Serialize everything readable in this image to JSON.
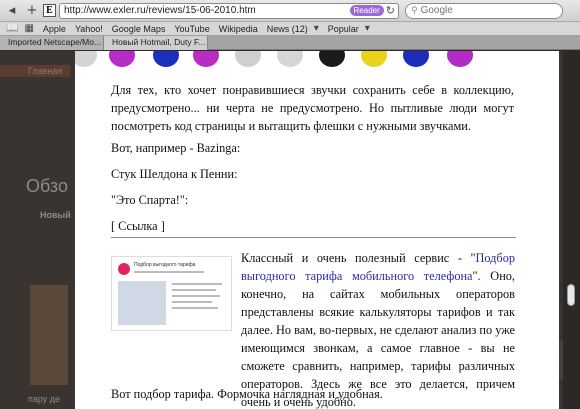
{
  "toolbar": {
    "back_icon": "back-icon",
    "add_icon": "add-bookmark-icon",
    "url": "http://www.exler.ru/reviews/15-06-2010.htm",
    "reader_label": "Reader",
    "search_placeholder": "Google"
  },
  "bookmarks": {
    "items": [
      "Apple",
      "Yahoo!",
      "Google Maps",
      "YouTube",
      "Wikipedia",
      "News (12)",
      "Popular"
    ]
  },
  "tabs": [
    {
      "label": "Imported Netscape/Mo..."
    },
    {
      "label": "Новый Hotmail, Duty F..."
    }
  ],
  "background": {
    "nav": "Главная",
    "heading": "Обзо",
    "label": "Новый",
    "caption": "пару  де"
  },
  "article": {
    "p1": "Для тех, кто хочет понравившиеся звучки сохранить себе в коллекцию, предусмотрено... ни черта не предусмотрено. Но пытливые люди могут посмотреть код страницы и вытащить флешки с нужными звучками.",
    "p2": "Вот, например - Bazinga:",
    "p3": "Стук Шелдона к Пенни:",
    "p4": "\"Это Спарта!\":",
    "p5": "[ Ссылка ]",
    "p6_before": "Классный и очень полезный сервис - \"",
    "p6_link": "Подбор выгодного тарифа мобильного телефона",
    "p6_after": "\". Оно, конечно, на сайтах мобильных операторов представлены всякие калькуляторы тарифов и так далее. Но вам, во-первых, не сделают анализ по уже имеющимся звонкам, а самое главное - вы не сможете сравнить, например, тарифы различных операторов. Здесь же все это делается, причем очень и очень удобно.",
    "p7": "Вот подбор тарифа. Формочка наглядная и удобная.",
    "thumb_title": "Подбор выгодного тарифа"
  },
  "colors": {
    "circles": [
      "#d4d4d4",
      "#b52cc7",
      "#1c2fbf",
      "#b82cc4",
      "#cfcfcf",
      "#d6d6d6",
      "#1a1a1a",
      "#e8d21a",
      "#1d2db8",
      "#b02cc4"
    ]
  }
}
